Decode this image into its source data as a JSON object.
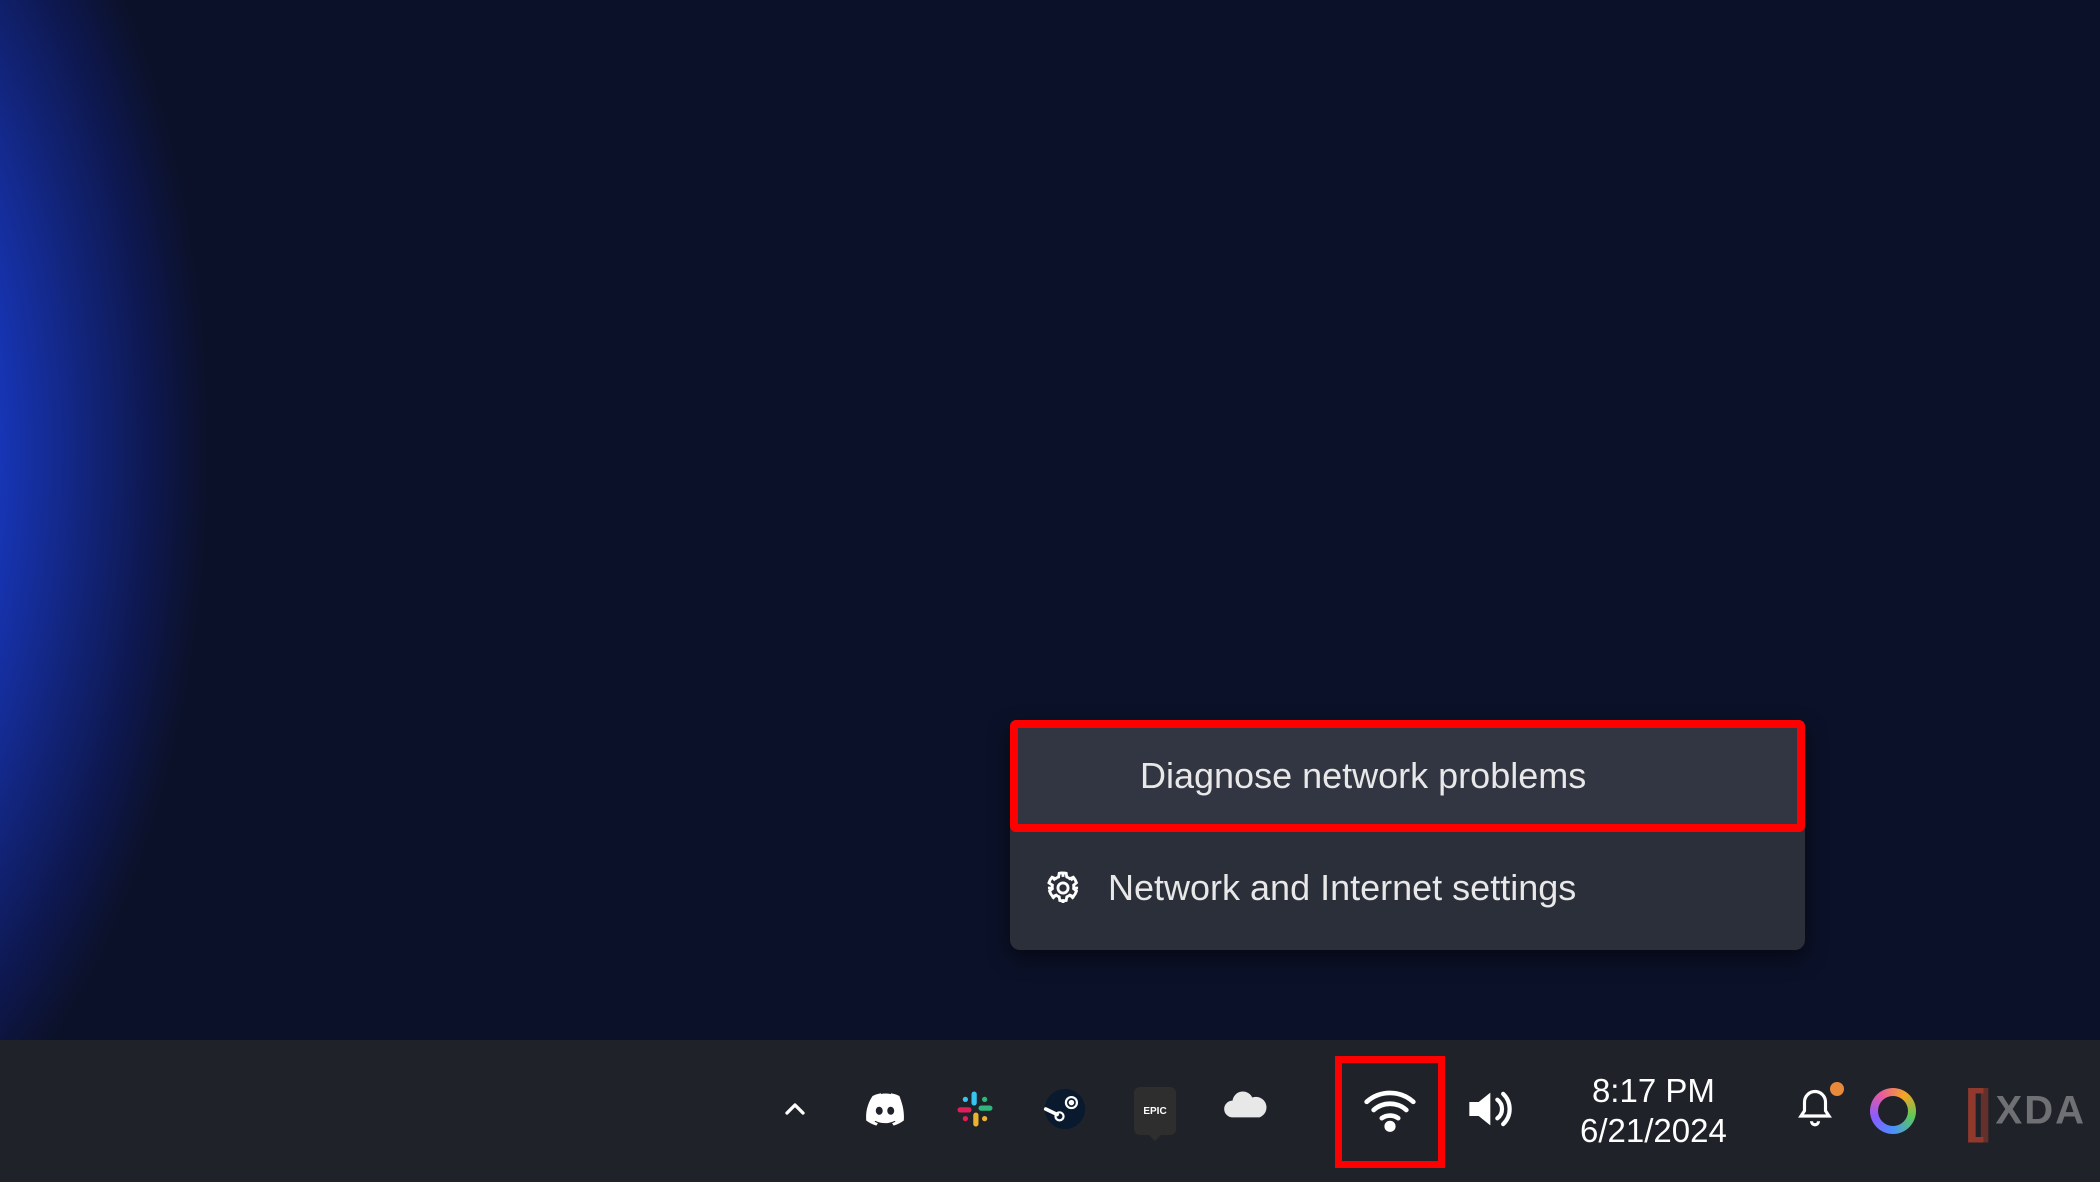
{
  "context_menu": {
    "items": [
      {
        "label": "Diagnose network problems",
        "has_icon": false,
        "highlighted": true
      },
      {
        "label": "Network and Internet settings",
        "has_icon": true,
        "icon": "gear-icon",
        "highlighted": false
      }
    ]
  },
  "taskbar": {
    "tray_icons": [
      {
        "name": "chevron-up-icon"
      },
      {
        "name": "discord-icon"
      },
      {
        "name": "slack-icon"
      },
      {
        "name": "steam-icon"
      },
      {
        "name": "epic-games-icon",
        "label": "EPIC"
      },
      {
        "name": "onedrive-icon"
      }
    ],
    "wifi_highlighted": true,
    "clock": {
      "time": "8:17 PM",
      "date": "6/21/2024"
    },
    "notification_icons": [
      {
        "name": "bell-icon"
      },
      {
        "name": "copilot-icon"
      }
    ]
  },
  "watermark": {
    "text": "XDA"
  },
  "colors": {
    "highlight_red": "#ff0000",
    "menu_bg": "#2b2f3a",
    "taskbar_bg": "#1f2229"
  }
}
